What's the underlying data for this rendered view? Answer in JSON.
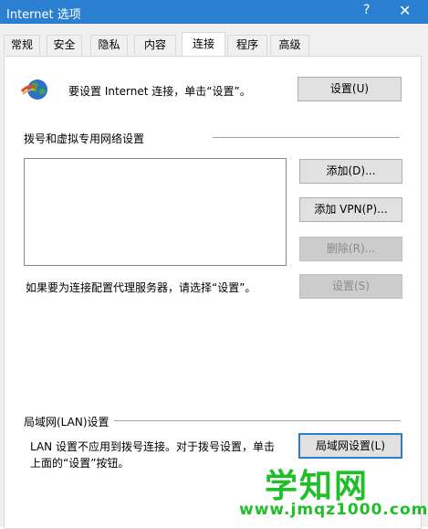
{
  "window": {
    "title": "Internet 选项",
    "help": "?",
    "close": "✕"
  },
  "tabs": [
    "常规",
    "安全",
    "隐私",
    "内容",
    "连接",
    "程序",
    "高级"
  ],
  "setup": {
    "text": "要设置 Internet 连接，单击“设置”。",
    "button": "设置(U)"
  },
  "dialup": {
    "heading": "拨号和虚拟专用网络设置",
    "add": "添加(D)...",
    "add_vpn": "添加 VPN(P)...",
    "remove": "删除(R)...",
    "proxy_text": "如果要为连接配置代理服务器，请选择“设置”。",
    "settings": "设置(S)"
  },
  "lan": {
    "heading": "局域网(LAN)设置",
    "line1": "LAN 设置不应用到拨号连接。对于拨号设置，单击",
    "line2": "上面的“设置”按钮。",
    "button": "局域网设置(L)"
  },
  "watermark": {
    "main": "学知网",
    "url": "www.jmqz1000.com"
  },
  "colors": {
    "titlebar": "#2b7fd1",
    "watermark": "#1fbf27"
  }
}
